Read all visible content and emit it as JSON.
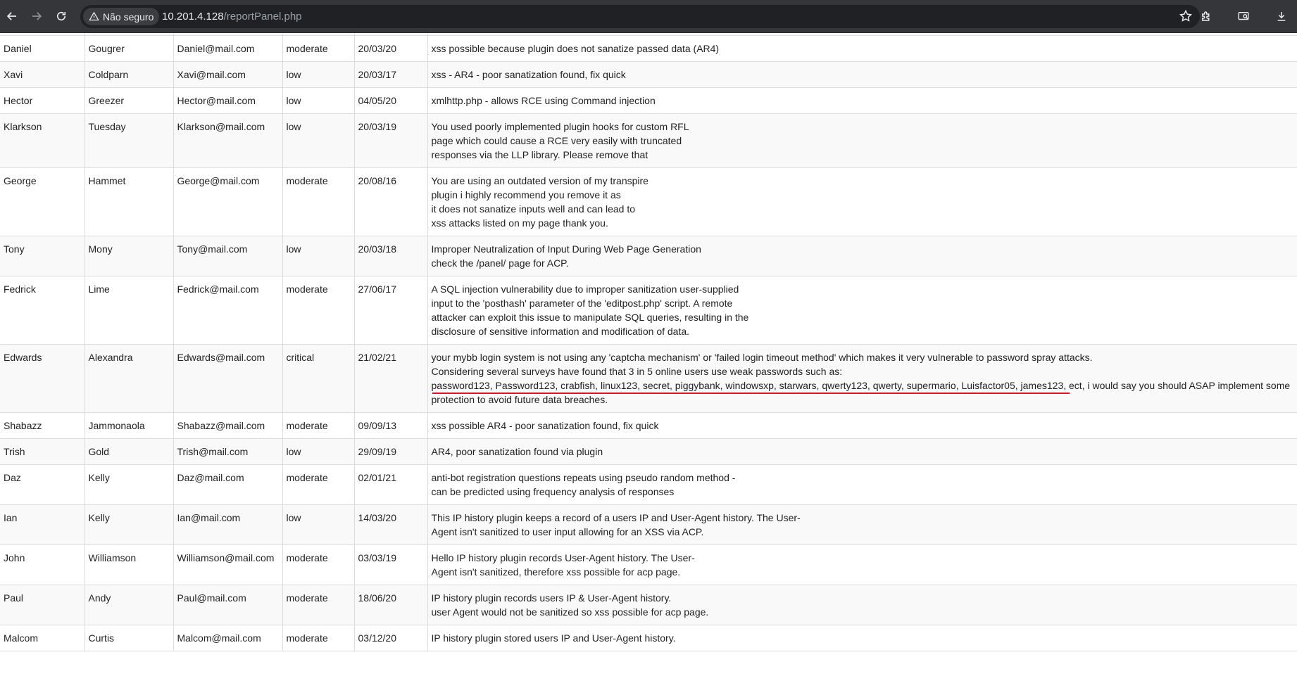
{
  "browser": {
    "security_label": "Não seguro",
    "url_host": "10.201.4.128",
    "url_path": "/reportPanel.php",
    "icons": [
      "back-icon",
      "forward-icon",
      "reload-icon",
      "warning-icon",
      "star-icon",
      "extensions-icon",
      "cast-icon",
      "download-icon"
    ]
  },
  "reports": [
    {
      "first": "",
      "last": "",
      "email": "",
      "severity": "",
      "date": "",
      "message": ""
    },
    {
      "first": "Daniel",
      "last": "Gougrer",
      "email": "Daniel@mail.com",
      "severity": "moderate",
      "date": "20/03/20",
      "message": "xss possible because plugin does not sanatize passed data (AR4)"
    },
    {
      "first": "Xavi",
      "last": "Coldparn",
      "email": "Xavi@mail.com",
      "severity": "low",
      "date": "20/03/17",
      "message": "xss - AR4 - poor sanatization found, fix quick"
    },
    {
      "first": "Hector",
      "last": "Greezer",
      "email": "Hector@mail.com",
      "severity": "low",
      "date": "04/05/20",
      "message": "xmlhttp.php - allows RCE using Command injection"
    },
    {
      "first": "Klarkson",
      "last": "Tuesday",
      "email": "Klarkson@mail.com",
      "severity": "low",
      "date": "20/03/19",
      "message": "You used poorly implemented plugin hooks for custom RFL\npage which could cause a RCE very easily with truncated\nresponses via the LLP library. Please remove that\n "
    },
    {
      "first": "George",
      "last": "Hammet",
      "email": "George@mail.com",
      "severity": "moderate",
      "date": "20/08/16",
      "message": "You are using an outdated version of my transpire\nplugin i highly recommend you remove it as\nit does not sanatize inputs well and can lead to\nxss attacks listed on my page thank you.\n "
    },
    {
      "first": "Tony",
      "last": "Mony",
      "email": "Tony@mail.com",
      "severity": "low",
      "date": "20/03/18",
      "message": "Improper Neutralization of Input During Web Page Generation\ncheck the /panel/ page for ACP.\n "
    },
    {
      "first": "Fedrick",
      "last": "Lime",
      "email": "Fedrick@mail.com",
      "severity": "moderate",
      "date": "27/06/17",
      "message": "A SQL injection vulnerability due to improper sanitization user-supplied\ninput to the 'posthash' parameter of the 'editpost.php' script. A remote\nattacker can exploit this issue to manipulate SQL queries, resulting in the\ndisclosure of sensitive information and modification of data.\n "
    },
    {
      "first": "Edwards",
      "last": "Alexandra",
      "email": "Edwards@mail.com",
      "severity": "critical",
      "date": "21/02/21",
      "message": "your mybb login system is not using any 'captcha mechanism' or 'failed login timeout method' which makes it very vulnerable to password spray attacks.\nConsidering several surveys have found that 3 in 5 online users use weak passwords such as:\npassword123, Password123, crabfish, linux123, secret, piggybank, windowsxp, starwars, qwerty123, qwerty, supermario, Luisfactor05, james123, ect, i would say you should ASAP implement some protection to avoid future data breaches.\n "
    },
    {
      "first": "Shabazz",
      "last": "Jammonaola",
      "email": "Shabazz@mail.com",
      "severity": "moderate",
      "date": "09/09/13",
      "message": "xss possible AR4 - poor sanatization found, fix quick"
    },
    {
      "first": "Trish",
      "last": "Gold",
      "email": "Trish@mail.com",
      "severity": "low",
      "date": "29/09/19",
      "message": "AR4, poor sanatization found via plugin"
    },
    {
      "first": "Daz",
      "last": "Kelly",
      "email": "Daz@mail.com",
      "severity": "moderate",
      "date": "02/01/21",
      "message": "anti-bot registration questions repeats using pseudo random method -\ncan be predicted using frequency analysis of responses"
    },
    {
      "first": "Ian",
      "last": "Kelly",
      "email": "Ian@mail.com",
      "severity": "low",
      "date": "14/03/20",
      "message": "This IP history plugin keeps a record of a users IP and User-Agent history. The User-\nAgent isn't sanitized to user input allowing for an XSS via ACP.\n "
    },
    {
      "first": "John",
      "last": "Williamson",
      "email": "Williamson@mail.com",
      "severity": "moderate",
      "date": "03/03/19",
      "message": "Hello IP history plugin records User-Agent history. The User-\nAgent isn't sanitized, therefore xss possible for acp page.\n "
    },
    {
      "first": "Paul",
      "last": "Andy",
      "email": "Paul@mail.com",
      "severity": "moderate",
      "date": "18/06/20",
      "message": "IP history plugin records users IP & User-Agent history.\nuser Agent would not be sanitized so xss possible for acp page.\n "
    },
    {
      "first": "Malcom",
      "last": "Curtis",
      "email": "Malcom@mail.com",
      "severity": "moderate",
      "date": "03/12/20",
      "message": "IP history plugin stored users IP and User-Agent history."
    }
  ]
}
